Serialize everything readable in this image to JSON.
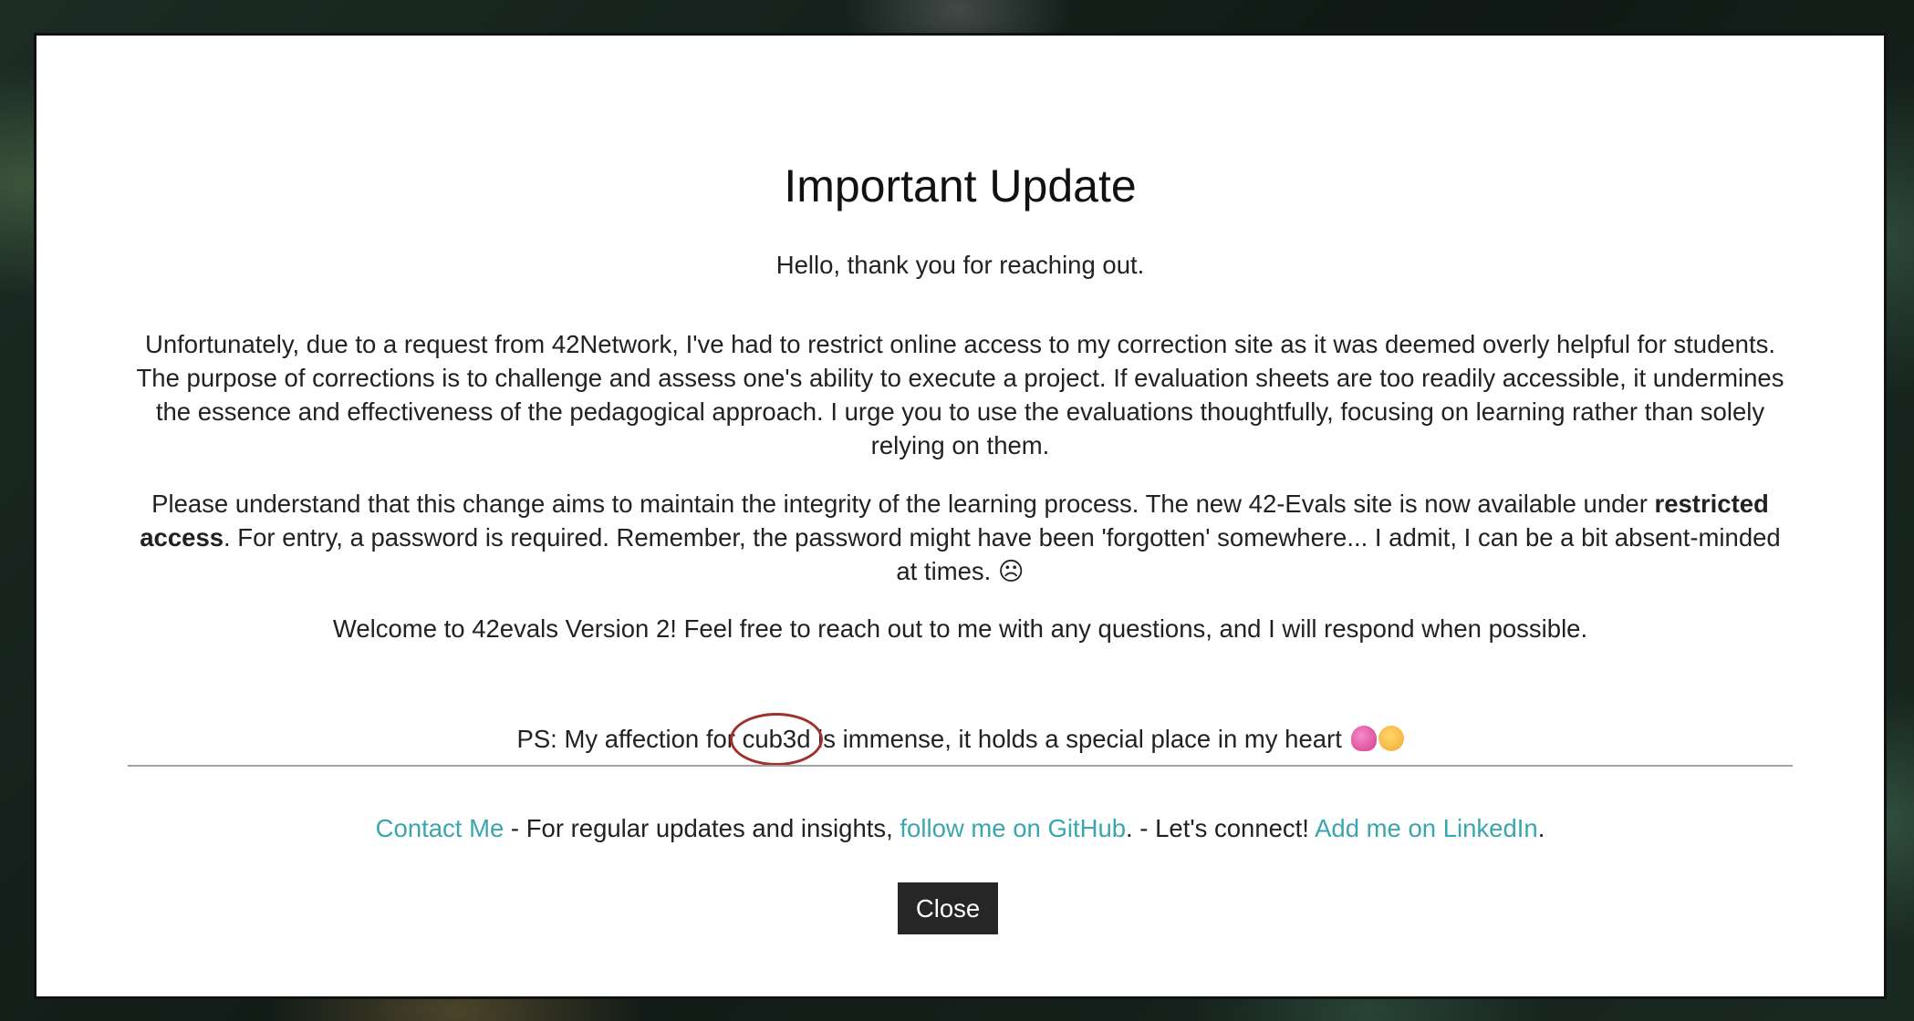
{
  "modal": {
    "title": "Important Update",
    "greeting": "Hello, thank you for reaching out.",
    "paragraph_unfortunately": "Unfortunately, due to a request from 42Network, I've had to restrict online access to my correction site as it was deemed overly helpful for students. The purpose of corrections is to challenge and assess one's ability to execute a project. If evaluation sheets are too readily accessible, it undermines the essence and effectiveness of the pedagogical approach. I urge you to use the evaluations thoughtfully, focusing on learning rather than solely relying on them.",
    "paragraph_please": {
      "before": "Please understand that this change aims to maintain the integrity of the learning process. The new 42-Evals site is now available under ",
      "bold": "restricted access",
      "after": ". For entry, a password is required. Remember, the password might have been 'forgotten' somewhere... I admit, I can be a bit absent-minded at times. ☹"
    },
    "paragraph_welcome": "Welcome to 42evals Version 2! Feel free to reach out to me with any questions, and I will respond when possible.",
    "ps": {
      "before": "PS: My affection for ",
      "highlight": "cub3d",
      "after": " is immense, it holds a special place in my heart ",
      "emojis": [
        "heart-with-sparkles",
        "smiling-face-with-hearts"
      ]
    },
    "footer": {
      "contact_link": "Contact Me",
      "text_1": " - For regular updates and insights, ",
      "github_link": "follow me on GitHub",
      "text_2": ". - Let's connect! ",
      "linkedin_link": "Add me on LinkedIn",
      "text_3": "."
    },
    "close_label": "Close"
  },
  "colors": {
    "link": "#3aa6ad",
    "button_bg": "#262626",
    "circle_annotation": "#a0312a"
  }
}
